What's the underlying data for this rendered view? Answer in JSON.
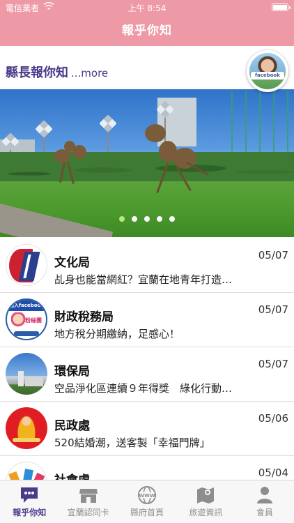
{
  "status_bar": {
    "carrier": "電信業者",
    "time": "上午 8:54",
    "battery_level": 1.0
  },
  "nav": {
    "title": "報乎你知"
  },
  "mayor": {
    "heading": "縣長報你知",
    "more": "...more",
    "badge_text": "facebook"
  },
  "banner": {
    "slide_count": 5,
    "active_index": 0
  },
  "news": [
    {
      "dept": "文化局",
      "date": "05/07",
      "summary": "乩身也能當網紅？宜蘭在地青年打造…",
      "thumb": "culture-bureau-logo"
    },
    {
      "dept": "財政稅務局",
      "date": "05/07",
      "summary": "地方稅分期繳納，足感心！",
      "thumb": "tax-bureau-fans-logo",
      "thumb_top": "加入facebook",
      "thumb_fans": "粉絲團"
    },
    {
      "dept": "環保局",
      "date": "05/07",
      "summary": "空品淨化區連續９年得獎　綠化行動…",
      "thumb": "environment-bureau-photo"
    },
    {
      "dept": "民政處",
      "date": "05/06",
      "summary": "520結婚潮，送客製「幸福門牌」",
      "thumb": "civil-affairs-logo"
    },
    {
      "dept": "社會處",
      "date": "05/04",
      "summary": "",
      "thumb": "social-affairs-logo"
    }
  ],
  "tabs": [
    {
      "label": "報乎你知",
      "icon": "chat-bubble-icon",
      "active": true
    },
    {
      "label": "宜蘭認同卡",
      "icon": "store-icon",
      "active": false
    },
    {
      "label": "縣府首頁",
      "icon": "www-globe-icon",
      "active": false
    },
    {
      "label": "旅遊資訊",
      "icon": "map-pin-icon",
      "active": false
    },
    {
      "label": "會員",
      "icon": "person-icon",
      "active": false
    }
  ],
  "colors": {
    "brand_pink": "#ee9aa6",
    "brand_purple": "#4b3a8a",
    "active_dot": "#b6e87a"
  }
}
